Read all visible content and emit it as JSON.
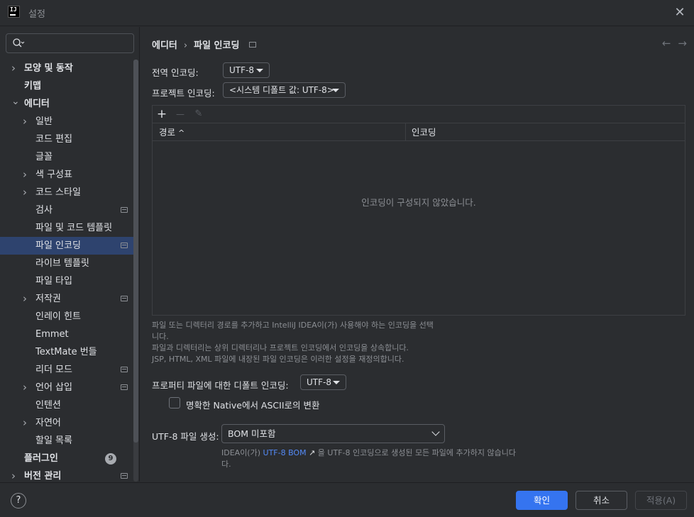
{
  "window": {
    "title": "설정"
  },
  "search": {
    "placeholder": ""
  },
  "sidebar": {
    "items": [
      {
        "label": "모양 및 동작",
        "level": 0,
        "expandable": true,
        "expanded": false,
        "bold": true
      },
      {
        "label": "키맵",
        "level": 0,
        "expandable": false,
        "bold": true
      },
      {
        "label": "에디터",
        "level": 0,
        "expandable": true,
        "expanded": true,
        "bold": true
      },
      {
        "label": "일반",
        "level": 1,
        "expandable": true,
        "expanded": false
      },
      {
        "label": "코드 편집",
        "level": 1,
        "expandable": false
      },
      {
        "label": "글꼴",
        "level": 1,
        "expandable": false
      },
      {
        "label": "색 구성표",
        "level": 1,
        "expandable": true,
        "expanded": false
      },
      {
        "label": "코드 스타일",
        "level": 1,
        "expandable": true,
        "expanded": false
      },
      {
        "label": "검사",
        "level": 1,
        "expandable": false,
        "project": true
      },
      {
        "label": "파일 및 코드 템플릿",
        "level": 1,
        "expandable": false
      },
      {
        "label": "파일 인코딩",
        "level": 1,
        "expandable": false,
        "project": true,
        "selected": true
      },
      {
        "label": "라이브 템플릿",
        "level": 1,
        "expandable": false
      },
      {
        "label": "파일 타입",
        "level": 1,
        "expandable": false
      },
      {
        "label": "저작권",
        "level": 1,
        "expandable": true,
        "expanded": false,
        "project": true
      },
      {
        "label": "인레이 힌트",
        "level": 1,
        "expandable": false
      },
      {
        "label": "Emmet",
        "level": 1,
        "expandable": false
      },
      {
        "label": "TextMate 번들",
        "level": 1,
        "expandable": false
      },
      {
        "label": "리더 모드",
        "level": 1,
        "expandable": false,
        "project": true
      },
      {
        "label": "언어 삽입",
        "level": 1,
        "expandable": true,
        "expanded": false,
        "project": true
      },
      {
        "label": "인텐션",
        "level": 1,
        "expandable": false
      },
      {
        "label": "자연어",
        "level": 1,
        "expandable": true,
        "expanded": false
      },
      {
        "label": "할일 목록",
        "level": 1,
        "expandable": false
      },
      {
        "label": "플러그인",
        "level": 0,
        "expandable": false,
        "bold": true,
        "badge": "9"
      },
      {
        "label": "버전 관리",
        "level": 0,
        "expandable": true,
        "expanded": false,
        "bold": true,
        "project": true
      }
    ]
  },
  "breadcrumb": {
    "parent": "에디터",
    "separator": "›",
    "current": "파일 인코딩"
  },
  "nav": {
    "back": "←",
    "forward": "→"
  },
  "global_encoding": {
    "label": "전역 인코딩:",
    "value": "UTF-8"
  },
  "project_encoding": {
    "label": "프로젝트 인코딩:",
    "value": "<시스템 디폴트 값: UTF-8>"
  },
  "table": {
    "toolbar": {
      "add": "+",
      "remove": "—",
      "edit": "✎"
    },
    "columns": [
      {
        "label": "경로",
        "sort": "^"
      },
      {
        "label": "인코딩"
      }
    ],
    "empty_text": "인코딩이 구성되지 않았습니다."
  },
  "hint1": {
    "line1": "파일 또는 디렉터리 경로를 추가하고 IntelliJ IDEA이(가) 사용해야 하는 인코딩을 선택",
    "line2": "니다.",
    "line3": "파일과 디렉터리는 상위 디렉터리나 프로젝트 인코딩에서 인코딩을 상속합니다.",
    "line4": "JSP, HTML, XML 파일에 내장된 파일 인코딩은 이러한 설정을 재정의합니다."
  },
  "properties_encoding": {
    "label": "프로퍼티 파일에 대한 디폴트 인코딩:",
    "value": "UTF-8"
  },
  "native_ascii": {
    "label": "명확한 Native에서 ASCII로의 변환",
    "checked": false
  },
  "bom": {
    "label": "UTF-8 파일 생성:",
    "value": "BOM 미포함",
    "hint_prefix": "IDEA이(가) ",
    "hint_link": "UTF-8 BOM",
    "hint_link_arrow": "↗",
    "hint_suffix": " 을 UTF-8 인코딩으로 생성된 모든 파일에 추가하지 않습니다",
    "hint_line2": "다."
  },
  "footer": {
    "help": "?",
    "ok": "확인",
    "cancel": "취소",
    "apply": "적용(A)"
  },
  "colors": {
    "accent": "#3574f0",
    "selected": "#2e436e",
    "link": "#548af7",
    "bg": "#2b2d30"
  }
}
